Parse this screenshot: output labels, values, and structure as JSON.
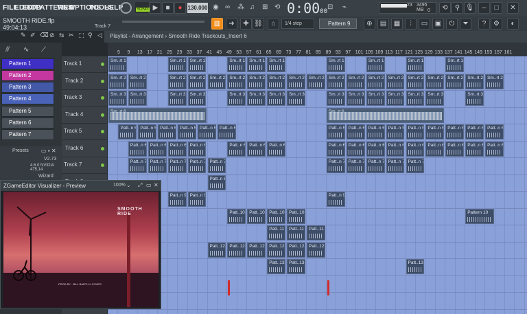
{
  "menu": {
    "items": [
      "FILE",
      "EDIT",
      "ADD",
      "PATTERNS",
      "VIEW",
      "OPTIONS",
      "TOOLS",
      "HELP"
    ]
  },
  "transport": {
    "song_mode": "SONG",
    "tempo": "130.000",
    "time": "0:00",
    "time_small": "00",
    "cpu": "23",
    "memory": "3495 MB",
    "voices": "0"
  },
  "song": {
    "title": "SMOOTH RIDE.flp",
    "time": "49:04:13",
    "current_track": "Track 7"
  },
  "snap": {
    "value": "1/4 step"
  },
  "pattern_selector": {
    "label": "Pattern 9"
  },
  "playlist": {
    "breadcrumb": "Playlist - Arrangement › Smooth Ride Trackouts_Insert 6"
  },
  "ruler": {
    "bars": [
      "5",
      "9",
      "13",
      "17",
      "21",
      "25",
      "29",
      "33",
      "37",
      "41",
      "45",
      "49",
      "53",
      "57",
      "61",
      "65",
      "69",
      "73",
      "77",
      "81",
      "85",
      "89",
      "93",
      "97",
      "101",
      "105",
      "109",
      "113",
      "117",
      "121",
      "125",
      "129",
      "133",
      "137",
      "141",
      "145",
      "149",
      "153",
      "157",
      "161"
    ]
  },
  "patterns": [
    {
      "label": "Pattern 1",
      "color": "#3f2fc4"
    },
    {
      "label": "Pattern 2",
      "color": "#c2389f"
    },
    {
      "label": "Pattern 3",
      "color": "#4458a8"
    },
    {
      "label": "Pattern 4",
      "color": "#4a62b8"
    },
    {
      "label": "Pattern 5",
      "color": "#4a5158"
    },
    {
      "label": "Pattern 6",
      "color": "#4a5158"
    },
    {
      "label": "Pattern 7",
      "color": "#4a5158"
    }
  ],
  "presets": {
    "label": "Presets",
    "version": "V2.73",
    "gpu": "4.6.0 NVIDIA 475.14",
    "wizard": "Wizard"
  },
  "tracks": [
    "Track 1",
    "Track 2",
    "Track 3",
    "Track 4",
    "Track 5",
    "Track 6",
    "Track 7",
    "Track 8"
  ],
  "preview": {
    "title": "ZGameEditor Visualizer - Preview",
    "zoom": "100%",
    "image_title": "SMOOTH RIDE",
    "image_caption": "PROD BY · BILL BARTH // COVER"
  },
  "clip_labels": {
    "t1": "Sm..rt 1",
    "t2": "Sm..rt 2",
    "t3": "Sm..rt 3",
    "t6": "Sm..rt 6",
    "p5": "Patt..n 5",
    "p6": "Patt..n 6",
    "p7": "Patt..n 7",
    "p8": "Patt..n 8",
    "p9": "Patt..n 9",
    "p10": "Patt..10",
    "p10full": "Pattern 10",
    "p11": "Patt..11",
    "p12": "Patt..12",
    "p13": "Patt..13"
  },
  "colors": {
    "accent": "#f28b16",
    "grid": "#8aa0d8",
    "clip": "#3d4c67"
  }
}
